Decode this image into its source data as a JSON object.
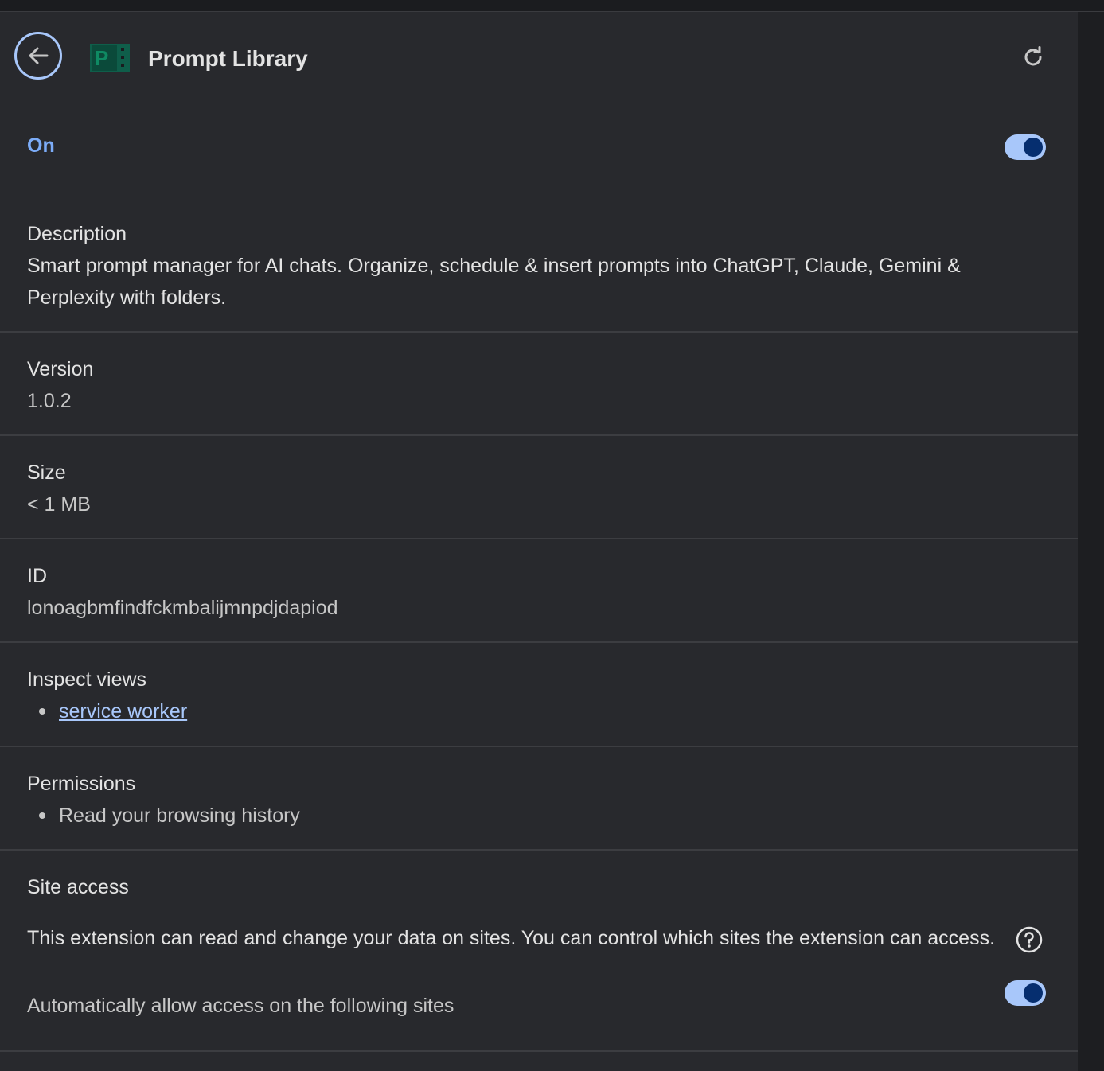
{
  "header": {
    "title": "Prompt Library",
    "logo_letter": "P"
  },
  "status": {
    "label": "On",
    "enabled": true
  },
  "description": {
    "label": "Description",
    "text": "Smart prompt manager for AI chats. Organize, schedule & insert prompts into ChatGPT, Claude, Gemini & Perplexity with folders."
  },
  "version": {
    "label": "Version",
    "value": "1.0.2"
  },
  "size": {
    "label": "Size",
    "value": "< 1 MB"
  },
  "id": {
    "label": "ID",
    "value": "lonoagbmfindfckmbalijmnpdjdapiod"
  },
  "inspect": {
    "label": "Inspect views",
    "items": [
      "service worker"
    ]
  },
  "permissions": {
    "label": "Permissions",
    "items": [
      "Read your browsing history"
    ]
  },
  "site_access": {
    "label": "Site access",
    "text": "This extension can read and change your data on sites. You can control which sites the extension can access.",
    "auto_allow_label": "Automatically allow access on the following sites",
    "auto_allow_enabled": true
  },
  "colors": {
    "accent": "#a8c7fa",
    "on_label": "#7cacf8",
    "toggle_knob": "#062e6f",
    "logo": "#0f5e4a",
    "panel_bg": "#28292d"
  },
  "icons": {
    "back": "back-arrow-icon",
    "reload": "reload-icon",
    "help": "help-icon"
  }
}
